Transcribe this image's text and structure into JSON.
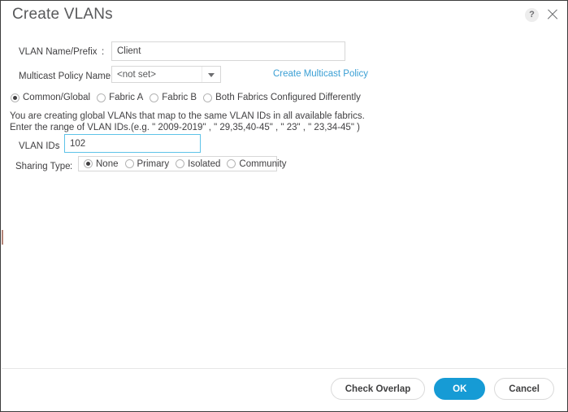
{
  "dialog": {
    "title": "Create VLANs",
    "help_icon_glyph": "?",
    "help_icon_name": "question-mark-icon",
    "close_icon_name": "close-icon"
  },
  "form": {
    "vlan_name": {
      "label": "VLAN Name/Prefix",
      "colon": ":",
      "value": "Client",
      "placeholder": ""
    },
    "multicast_policy": {
      "label": "Multicast Policy Name",
      "colon": ":",
      "selected": "<not set>",
      "options": [
        "<not set>"
      ]
    },
    "create_multicast_policy_link": "Create Multicast Policy",
    "scope": {
      "options": [
        {
          "label": "Common/Global",
          "selected": true
        },
        {
          "label": "Fabric A",
          "selected": false
        },
        {
          "label": "Fabric B",
          "selected": false
        },
        {
          "label": "Both Fabrics Configured Differently",
          "selected": false
        }
      ]
    },
    "description_line1": "You are creating global VLANs that map to the same VLAN IDs in all available fabrics.",
    "description_line2": "Enter the range of VLAN IDs.(e.g. \" 2009-2019\" , \" 29,35,40-45\" , \" 23\" , \" 23,34-45\" )",
    "vlan_ids": {
      "label": "VLAN IDs",
      "colon": ":",
      "value": "102",
      "placeholder": "",
      "focused": true
    },
    "sharing_type": {
      "label": "Sharing Type",
      "colon": ":",
      "options": [
        {
          "label": "None",
          "selected": true
        },
        {
          "label": "Primary",
          "selected": false
        },
        {
          "label": "Isolated",
          "selected": false
        },
        {
          "label": "Community",
          "selected": false
        }
      ]
    }
  },
  "footer": {
    "check_overlap_label": "Check Overlap",
    "ok_label": "OK",
    "cancel_label": "Cancel"
  },
  "colors": {
    "accent_blue": "#169bd5",
    "link_blue": "#3a9fd4",
    "focus_border": "#5ec3e8",
    "text": "#414042",
    "title_text": "#58595b"
  }
}
